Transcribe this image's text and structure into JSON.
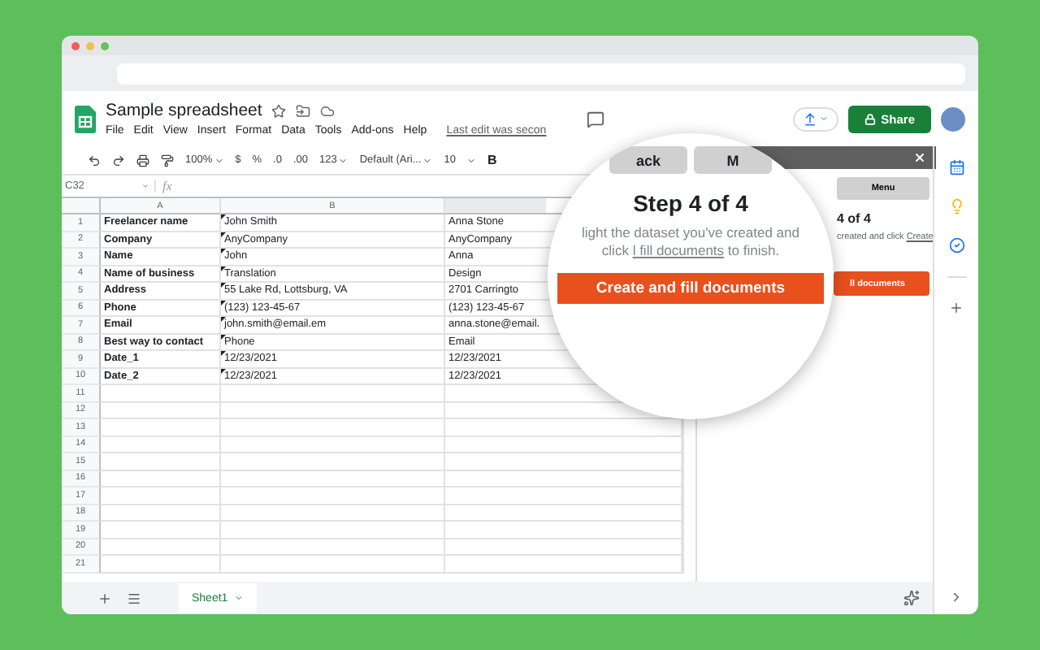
{
  "window": {
    "traffic_lights": [
      {
        "color": "#ee5f57"
      },
      {
        "color": "#f5bd4f"
      },
      {
        "color": "#62c554"
      }
    ]
  },
  "document": {
    "title": "Sample spreadsheet",
    "last_edit": "Last edit was secon"
  },
  "menu": [
    "File",
    "Edit",
    "View",
    "Insert",
    "Format",
    "Data",
    "Tools",
    "Add-ons",
    "Help"
  ],
  "share_button": "Share",
  "toolbar": {
    "zoom": "100%",
    "currency": "$",
    "percent": "%",
    "decrease_decimals": ".0",
    "increase_decimals": ".00",
    "number_format": "123",
    "font": "Default (Ari...",
    "font_size": "10",
    "bold": "B"
  },
  "formula_bar": {
    "cell_ref": "C32",
    "fx": "fx"
  },
  "grid": {
    "columns": [
      "A",
      "B"
    ],
    "rows": [
      {
        "number": "1",
        "note": true,
        "cells": [
          "Freelancer name",
          "John Smith",
          "Anna Stone"
        ]
      },
      {
        "number": "2",
        "note": true,
        "cells": [
          "Company",
          "AnyCompany",
          "AnyCompany"
        ]
      },
      {
        "number": "3",
        "note": true,
        "cells": [
          "Name",
          "John",
          "Anna"
        ]
      },
      {
        "number": "4",
        "note": true,
        "cells": [
          "Name of business",
          "Translation",
          "Design"
        ]
      },
      {
        "number": "5",
        "note": true,
        "cells": [
          "Address",
          "55 Lake Rd, Lottsburg, VA",
          "2701 Carringto"
        ]
      },
      {
        "number": "6",
        "note": true,
        "cells": [
          "Phone",
          "(123) 123-45-67",
          "(123) 123-45-67"
        ]
      },
      {
        "number": "7",
        "note": true,
        "cells": [
          "Email",
          "john.smith@email.em",
          "anna.stone@email."
        ]
      },
      {
        "number": "8",
        "note": true,
        "cells": [
          "Best way to contact",
          "Phone",
          "Email"
        ]
      },
      {
        "number": "9",
        "note": true,
        "cells": [
          "Date_1",
          "12/23/2021",
          "12/23/2021"
        ]
      },
      {
        "number": "10",
        "note": true,
        "cells": [
          "Date_2",
          "12/23/2021",
          "12/23/2021"
        ]
      },
      {
        "number": "11"
      },
      {
        "number": "12"
      },
      {
        "number": "13"
      },
      {
        "number": "14"
      },
      {
        "number": "15"
      },
      {
        "number": "16"
      },
      {
        "number": "17"
      },
      {
        "number": "18"
      },
      {
        "number": "19"
      },
      {
        "number": "20"
      },
      {
        "number": "21"
      }
    ]
  },
  "sheet_tabs": [
    {
      "label": "Sheet1",
      "selected": true
    }
  ],
  "side_panel": {
    "menu_button": "Menu",
    "step": "4 of 4",
    "text": "created and click ",
    "link": "Create",
    "action_button": "ll documents"
  },
  "magnifier": {
    "buttons": [
      "ack",
      "M"
    ],
    "title": "Step 4 of 4",
    "text_start": "light the dataset you've created and click ",
    "link": "l fill documents",
    "text_end": " to finish.",
    "action_button": "Create and fill documents"
  }
}
